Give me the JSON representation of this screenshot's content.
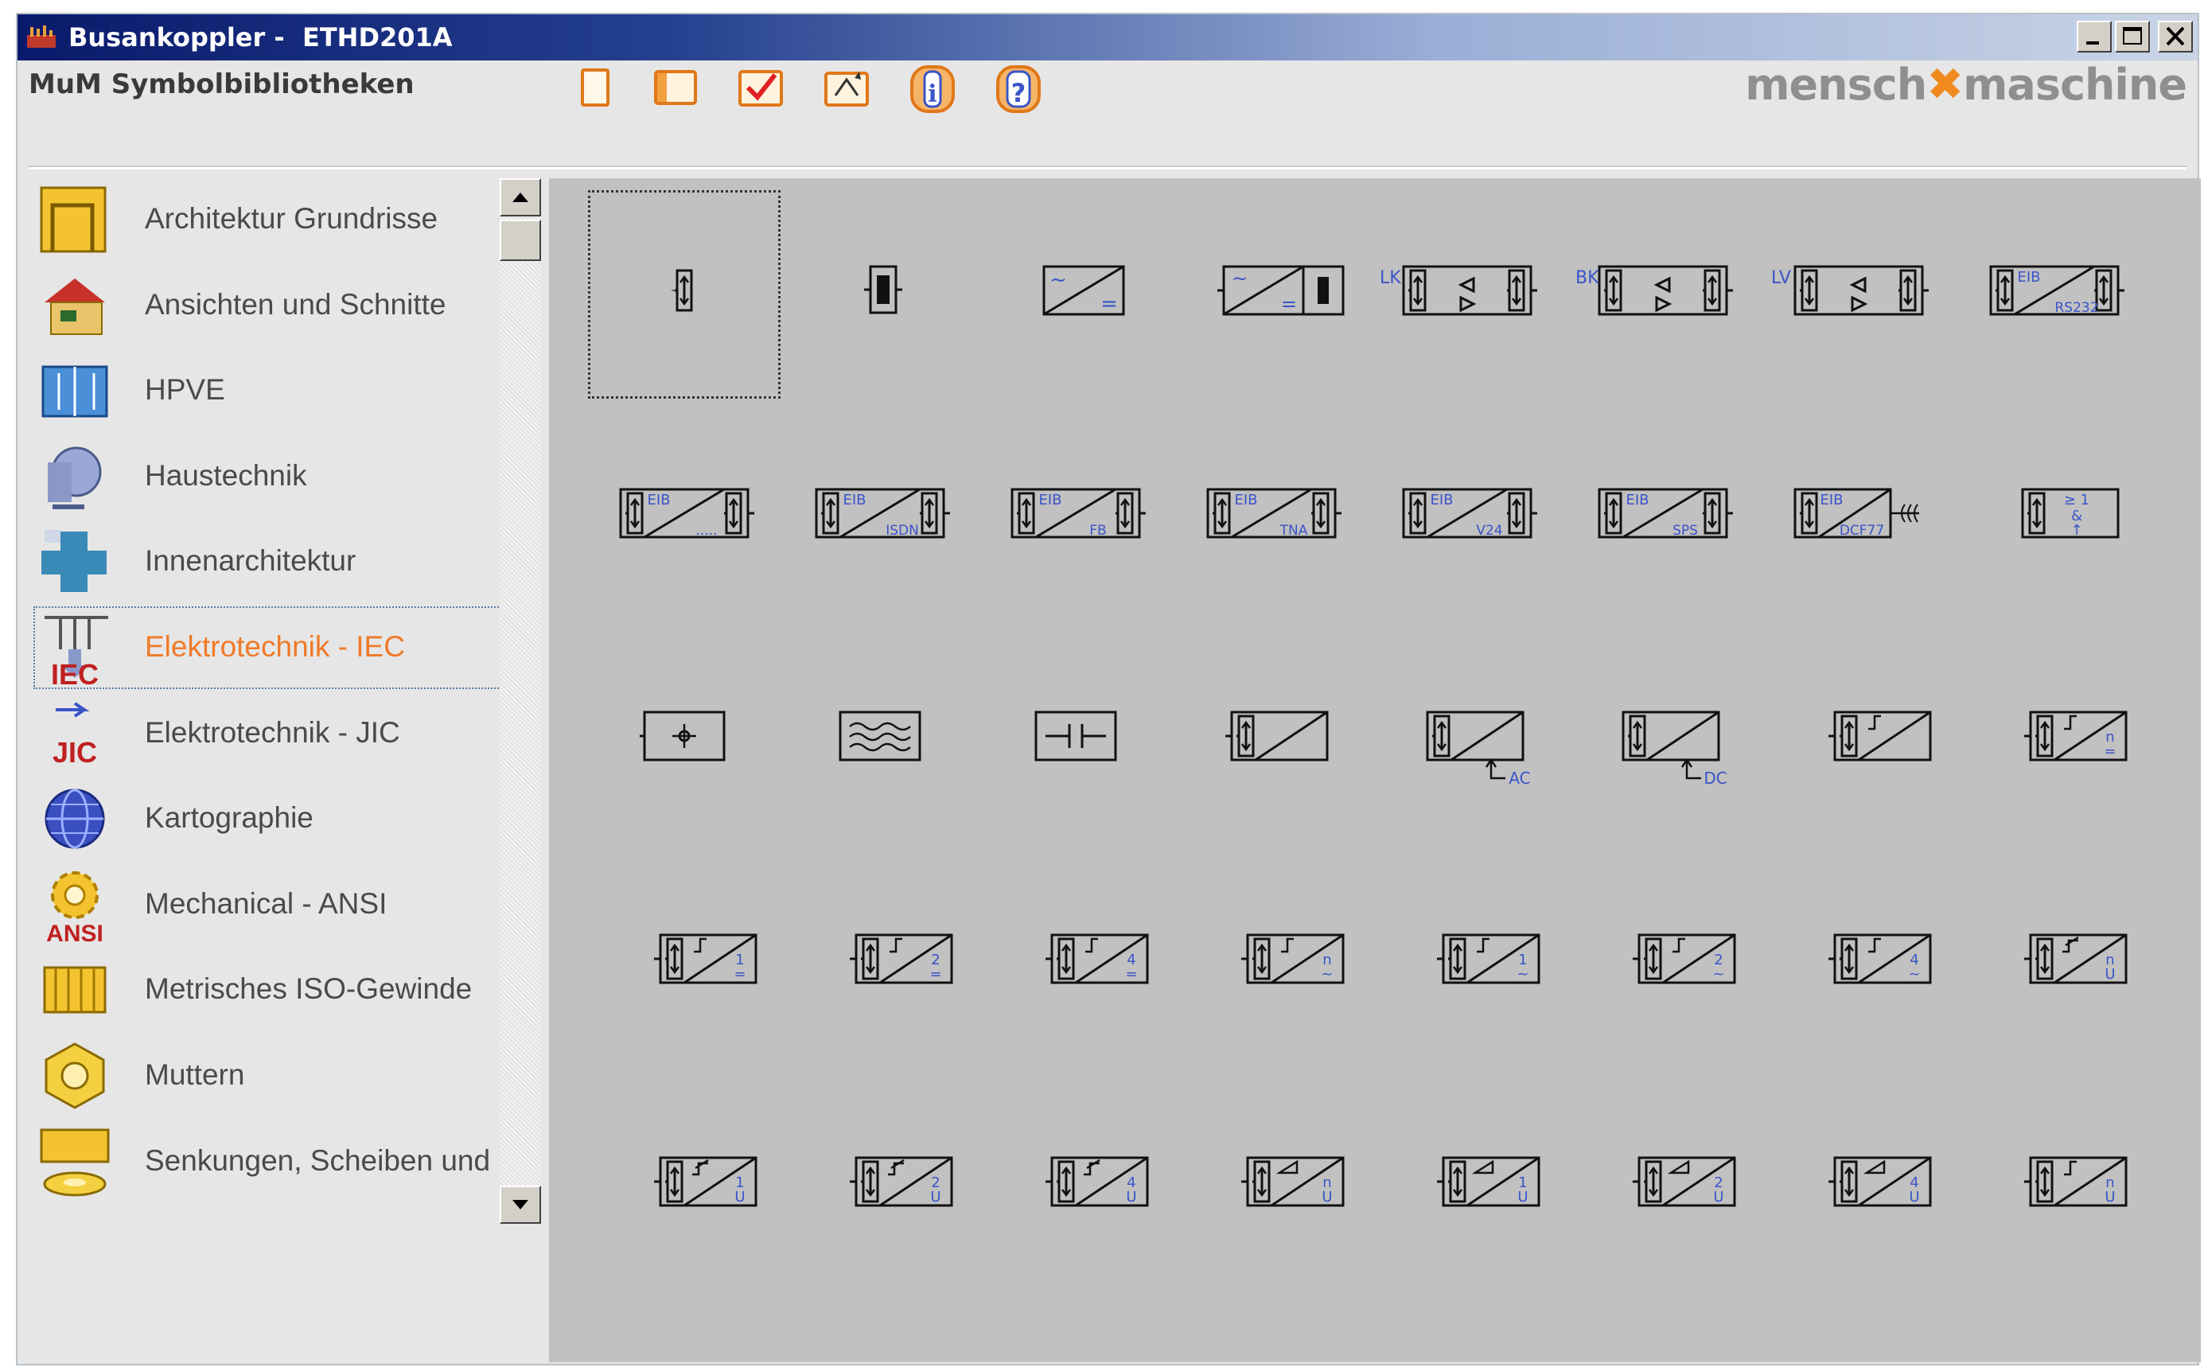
{
  "window": {
    "title": "Busankoppler -  ETHD201A",
    "controls": [
      "minimize",
      "maximize",
      "close"
    ]
  },
  "header": {
    "library_title": "MuM Symbolbibliotheken",
    "toolbar": [
      {
        "name": "new-page-button",
        "icon": "page-icon"
      },
      {
        "name": "panel-button",
        "icon": "panel-icon"
      },
      {
        "name": "check-button",
        "icon": "checkmark-icon"
      },
      {
        "name": "refresh-button",
        "icon": "refresh-icon"
      },
      {
        "name": "info-button",
        "icon": "info-icon"
      },
      {
        "name": "help-button",
        "icon": "help-icon"
      }
    ],
    "brand": {
      "left": "mensch",
      "right": "maschine"
    }
  },
  "sidebar": {
    "items": [
      {
        "label": "Architektur Grundrisse",
        "icon": "floorplan-icon",
        "selected": false
      },
      {
        "label": "Ansichten und Schnitte",
        "icon": "house-icon",
        "selected": false
      },
      {
        "label": "HPVE",
        "icon": "hpve-icon",
        "selected": false
      },
      {
        "label": "Haustechnik",
        "icon": "hvac-icon",
        "selected": false
      },
      {
        "label": "Innenarchitektur",
        "icon": "interior-icon",
        "selected": false
      },
      {
        "label": "Elektrotechnik - IEC",
        "icon": "iec-icon",
        "icon_text": "IEC",
        "selected": true
      },
      {
        "label": "Elektrotechnik - JIC",
        "icon": "jic-icon",
        "icon_text": "JIC",
        "selected": false
      },
      {
        "label": "Kartographie",
        "icon": "globe-icon",
        "selected": false
      },
      {
        "label": "Mechanical - ANSI",
        "icon": "gear-icon",
        "icon_text": "ANSI",
        "selected": false
      },
      {
        "label": "Metrisches ISO-Gewinde",
        "icon": "thread-icon",
        "selected": false
      },
      {
        "label": "Muttern",
        "icon": "nut-icon",
        "selected": false
      },
      {
        "label": "Senkungen, Scheiben und Du",
        "icon": "washer-icon",
        "selected": false
      }
    ]
  },
  "symbols": {
    "rows": [
      [
        {
          "kind": "slot1",
          "selected": true
        },
        {
          "kind": "slot2"
        },
        {
          "kind": "acdc"
        },
        {
          "kind": "acdc_bat"
        },
        {
          "kind": "coupler",
          "prefix": "LK"
        },
        {
          "kind": "coupler",
          "prefix": "BK"
        },
        {
          "kind": "coupler",
          "prefix": "LV"
        },
        {
          "kind": "eib",
          "top": "EIB",
          "bottom": "RS232"
        }
      ],
      [
        {
          "kind": "eib",
          "top": "EIB",
          "bottom": "....."
        },
        {
          "kind": "eib",
          "top": "EIB",
          "bottom": "ISDN"
        },
        {
          "kind": "eib",
          "top": "EIB",
          "bottom": "FB"
        },
        {
          "kind": "eib",
          "top": "EIB",
          "bottom": "TNA"
        },
        {
          "kind": "eib",
          "top": "EIB",
          "bottom": "V24"
        },
        {
          "kind": "eib",
          "top": "EIB",
          "bottom": "SPS"
        },
        {
          "kind": "eib_antenna",
          "top": "EIB",
          "bottom": "DCF77"
        },
        {
          "kind": "logic",
          "lines": [
            "≥ 1",
            "&",
            "↑"
          ]
        }
      ],
      [
        {
          "kind": "crosshair"
        },
        {
          "kind": "waves"
        },
        {
          "kind": "capacitor"
        },
        {
          "kind": "slash_in"
        },
        {
          "kind": "slash_supply",
          "label": "AC"
        },
        {
          "kind": "slash_supply",
          "label": "DC"
        },
        {
          "kind": "step",
          "bottom": ""
        },
        {
          "kind": "step",
          "bottom": "n ="
        }
      ],
      [
        {
          "kind": "step",
          "bottom": "1 ="
        },
        {
          "kind": "step",
          "bottom": "2 ="
        },
        {
          "kind": "step",
          "bottom": "4 ="
        },
        {
          "kind": "step",
          "bottom": "n ~"
        },
        {
          "kind": "step",
          "bottom": "1 ~"
        },
        {
          "kind": "step",
          "bottom": "2 ~"
        },
        {
          "kind": "step",
          "bottom": "4 ~"
        },
        {
          "kind": "dim",
          "bottom": "n U"
        }
      ],
      [
        {
          "kind": "dim",
          "bottom": "1 U"
        },
        {
          "kind": "dim",
          "bottom": "2 U"
        },
        {
          "kind": "dim",
          "bottom": "4 U"
        },
        {
          "kind": "ramp",
          "bottom": "n U"
        },
        {
          "kind": "ramp",
          "bottom": "1 U"
        },
        {
          "kind": "ramp",
          "bottom": "2 U"
        },
        {
          "kind": "ramp",
          "bottom": "4 U"
        },
        {
          "kind": "step",
          "bottom": "n U"
        }
      ]
    ]
  },
  "colors": {
    "accent": "#f07a28",
    "symbol_label": "#3a54c8",
    "panel": "#c1c1c1"
  }
}
